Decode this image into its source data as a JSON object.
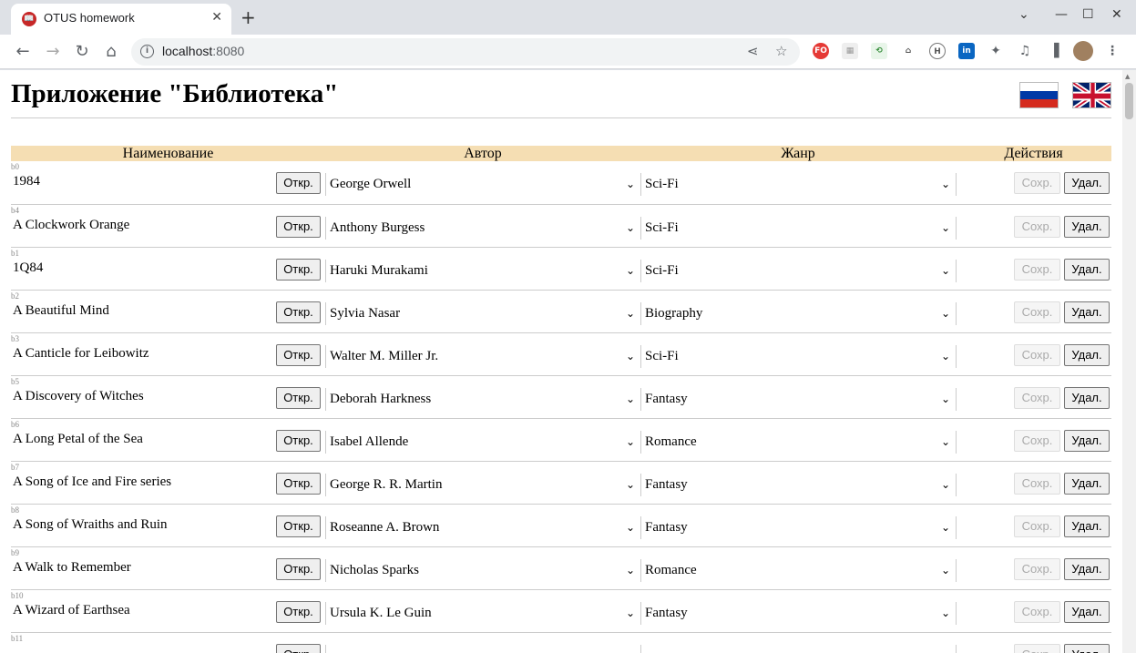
{
  "browser": {
    "tab_title": "OTUS homework",
    "tab_close": "✕",
    "new_tab": "+",
    "url_host": "localhost",
    "url_port": ":8080"
  },
  "page": {
    "heading": "Приложение \"Библиотека\"",
    "columns": [
      "Наименование",
      "Автор",
      "Жанр",
      "Действия"
    ],
    "open_label": "Откр.",
    "save_label": "Сохр.",
    "delete_label": "Удал.",
    "books": [
      {
        "id": "b0",
        "title": "1984",
        "author": "George Orwell",
        "genre": "Sci-Fi"
      },
      {
        "id": "b4",
        "title": "A Clockwork Orange",
        "author": "Anthony Burgess",
        "genre": "Sci-Fi"
      },
      {
        "id": "b1",
        "title": "1Q84",
        "author": "Haruki Murakami",
        "genre": "Sci-Fi"
      },
      {
        "id": "b2",
        "title": "A Beautiful Mind",
        "author": "Sylvia Nasar",
        "genre": "Biography"
      },
      {
        "id": "b3",
        "title": "A Canticle for Leibowitz",
        "author": "Walter M. Miller Jr.",
        "genre": "Sci-Fi"
      },
      {
        "id": "b5",
        "title": "A Discovery of Witches",
        "author": "Deborah Harkness",
        "genre": "Fantasy"
      },
      {
        "id": "b6",
        "title": "A Long Petal of the Sea",
        "author": "Isabel Allende",
        "genre": "Romance"
      },
      {
        "id": "b7",
        "title": "A Song of Ice and Fire series",
        "author": "George R. R. Martin",
        "genre": "Fantasy"
      },
      {
        "id": "b8",
        "title": "A Song of Wraiths and Ruin",
        "author": "Roseanne A. Brown",
        "genre": "Fantasy"
      },
      {
        "id": "b9",
        "title": "A Walk to Remember",
        "author": "Nicholas Sparks",
        "genre": "Romance"
      },
      {
        "id": "b10",
        "title": "A Wizard of Earthsea",
        "author": "Ursula K. Le Guin",
        "genre": "Fantasy"
      },
      {
        "id": "b11",
        "title": "",
        "author": "",
        "genre": ""
      }
    ]
  }
}
